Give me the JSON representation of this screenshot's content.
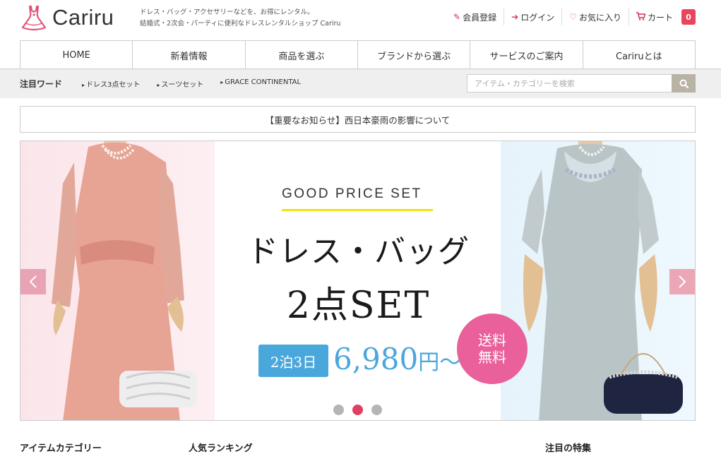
{
  "header": {
    "brand": "Cariru",
    "tagline1": "ドレス・バッグ・アクセサリーなどを、お得にレンタル。",
    "tagline2": "結婚式・2次会・パーティに便利なドレスレンタルショップ Cariru",
    "nav": {
      "register": "会員登録",
      "login": "ログイン",
      "favorites": "お気に入り",
      "cart": "カート",
      "cart_count": "0"
    }
  },
  "global_nav": [
    "HOME",
    "新着情報",
    "商品を選ぶ",
    "ブランドから選ぶ",
    "サービスのご案内",
    "Cariruとは"
  ],
  "keywords": {
    "title": "注目ワード",
    "items": [
      "ドレス3点セット",
      "スーツセット",
      "GRACE CONTINENTAL"
    ]
  },
  "search": {
    "placeholder": "アイテム・カテゴリーを検索"
  },
  "notice": "【重要なお知らせ】西日本豪雨の影響について",
  "slide": {
    "eyebrow": "GOOD PRICE SET",
    "headline1": "ドレス・バッグ",
    "headline2": "2点SET",
    "badge_line1": "送料",
    "badge_line2": "無料",
    "stay": "2泊3日",
    "price": "6,980",
    "price_suffix": "円〜",
    "active_index": 1,
    "dot_count": 3
  },
  "sections": {
    "category": "アイテムカテゴリー",
    "ranking": "人気ランキング",
    "feature": "注目の特集"
  },
  "colors": {
    "accent": "#e8455e",
    "price_blue": "#4aa7dc",
    "badge_pink": "#e9609a",
    "underline_yellow": "#f1e21a"
  }
}
